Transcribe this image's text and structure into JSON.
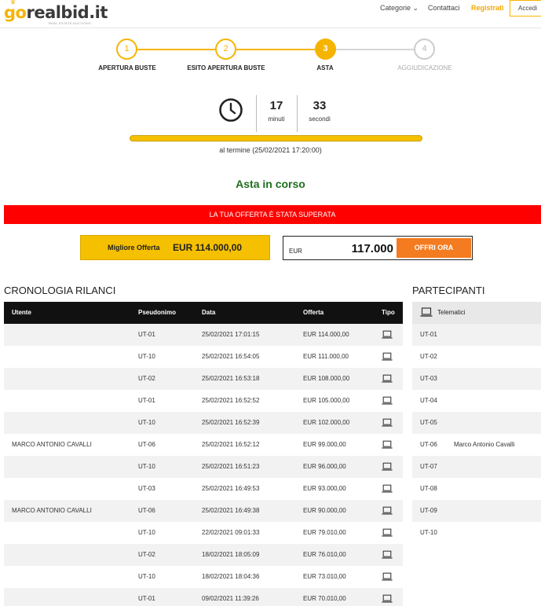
{
  "header": {
    "logo_go": "go",
    "logo_rest": "realbid.it",
    "logo_tagline": "REAL ESTATE AUCTIONS",
    "nav_categorie": "Categorie ⌄",
    "nav_contattaci": "Contattaci",
    "nav_registrati": "Registrati",
    "nav_accedi": "Accedi"
  },
  "steps": [
    {
      "number": "1",
      "label": "APERTURA BUSTE",
      "state": "done"
    },
    {
      "number": "2",
      "label": "ESITO APERTURA BUSTE",
      "state": "done"
    },
    {
      "number": "3",
      "label": "ASTA",
      "state": "active"
    },
    {
      "number": "4",
      "label": "AGGIUDICAZIONE",
      "state": "future"
    }
  ],
  "countdown": {
    "icon": "clock-icon",
    "minutes_value": "17",
    "minutes_label": "minuti",
    "seconds_value": "33",
    "seconds_label": "secondi",
    "progress_fraction": 1.0,
    "end_text": "al termine (25/02/2021 17:20:00)"
  },
  "status": {
    "title": "Asta in corso",
    "alert": "LA TUA OFFERTA È STATA SUPERATA"
  },
  "best_offer": {
    "label": "Migliore Offerta",
    "value": "EUR 114.000,00"
  },
  "offer_form": {
    "currency": "EUR",
    "amount": "117.000",
    "button": "OFFRI ORA"
  },
  "history": {
    "title": "CRONOLOGIA RILANCI",
    "columns": [
      "Utente",
      "Pseudonimo",
      "Data",
      "Offerta",
      "Tipo"
    ],
    "rows": [
      {
        "user": "",
        "pseudo": "UT-01",
        "date": "25/02/2021 17:01:15",
        "offer": "EUR 114.000,00"
      },
      {
        "user": "",
        "pseudo": "UT-10",
        "date": "25/02/2021 16:54:05",
        "offer": "EUR 111.000,00"
      },
      {
        "user": "",
        "pseudo": "UT-02",
        "date": "25/02/2021 16:53:18",
        "offer": "EUR 108.000,00"
      },
      {
        "user": "",
        "pseudo": "UT-01",
        "date": "25/02/2021 16:52:52",
        "offer": "EUR 105.000,00"
      },
      {
        "user": "",
        "pseudo": "UT-10",
        "date": "25/02/2021 16:52:39",
        "offer": "EUR 102.000,00"
      },
      {
        "user": "MARCO ANTONIO CAVALLI",
        "pseudo": "UT-06",
        "date": "25/02/2021 16:52:12",
        "offer": "EUR 99.000,00"
      },
      {
        "user": "",
        "pseudo": "UT-10",
        "date": "25/02/2021 16:51:23",
        "offer": "EUR 96.000,00"
      },
      {
        "user": "",
        "pseudo": "UT-03",
        "date": "25/02/2021 16:49:53",
        "offer": "EUR 93.000,00"
      },
      {
        "user": "MARCO ANTONIO CAVALLI",
        "pseudo": "UT-06",
        "date": "25/02/2021 16:49:38",
        "offer": "EUR 90.000,00"
      },
      {
        "user": "",
        "pseudo": "UT-10",
        "date": "22/02/2021 09:01:33",
        "offer": "EUR 79.010,00"
      },
      {
        "user": "",
        "pseudo": "UT-02",
        "date": "18/02/2021 18:05:09",
        "offer": "EUR 76.010,00"
      },
      {
        "user": "",
        "pseudo": "UT-10",
        "date": "18/02/2021 18:04:36",
        "offer": "EUR 73.010,00"
      },
      {
        "user": "",
        "pseudo": "UT-01",
        "date": "09/02/2021 11:39:26",
        "offer": "EUR 70.010,00"
      }
    ],
    "type_icon": "laptop-icon"
  },
  "participants": {
    "title": "PARTECIPANTI",
    "header_label": "Telematici",
    "header_icon": "laptop-icon",
    "rows": [
      {
        "code": "UT-01",
        "name": ""
      },
      {
        "code": "UT-02",
        "name": ""
      },
      {
        "code": "UT-03",
        "name": ""
      },
      {
        "code": "UT-04",
        "name": ""
      },
      {
        "code": "UT-05",
        "name": ""
      },
      {
        "code": "UT-06",
        "name": "Marco Antonio Cavalli"
      },
      {
        "code": "UT-07",
        "name": ""
      },
      {
        "code": "UT-08",
        "name": ""
      },
      {
        "code": "UT-09",
        "name": ""
      },
      {
        "code": "UT-10",
        "name": ""
      }
    ]
  },
  "colors": {
    "accent": "#f5b400",
    "alert": "#ff0000",
    "button": "#f47b20",
    "status": "#1e6f1e"
  }
}
